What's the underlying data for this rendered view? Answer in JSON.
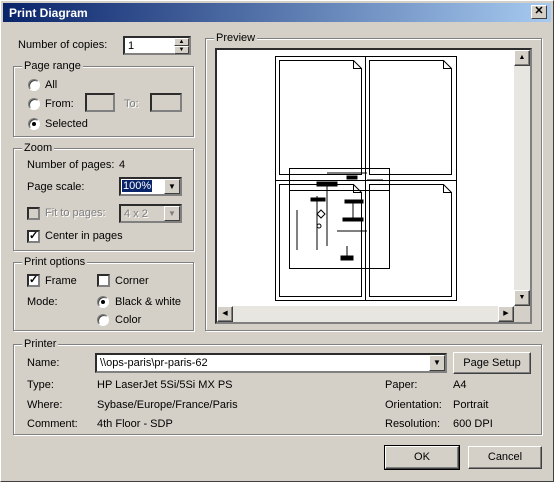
{
  "window": {
    "title": "Print Diagram",
    "close_glyph": "✕"
  },
  "copies": {
    "label": "Number of copies:",
    "value": "1"
  },
  "page_range": {
    "legend": "Page range",
    "all_label": "All",
    "from_label": "From:",
    "to_label": "To:",
    "selected_label": "Selected",
    "selected": "Selected"
  },
  "zoom": {
    "legend": "Zoom",
    "num_pages_label": "Number of pages:",
    "num_pages_value": "4",
    "page_scale_label": "Page scale:",
    "page_scale_value": "100%",
    "fit_label": "Fit to pages:",
    "fit_value": "4 x 2",
    "center_label": "Center in pages",
    "center_checked": true,
    "fit_checked": false
  },
  "print_options": {
    "legend": "Print options",
    "frame_label": "Frame",
    "frame_checked": true,
    "corner_label": "Corner",
    "corner_checked": false,
    "mode_label": "Mode:",
    "bw_label": "Black & white",
    "color_label": "Color",
    "mode": "Black & white"
  },
  "preview": {
    "legend": "Preview"
  },
  "printer": {
    "legend": "Printer",
    "name_label": "Name:",
    "name_value": "\\\\ops-paris\\pr-paris-62",
    "page_setup_label": "Page Setup",
    "type_label": "Type:",
    "type_value": "HP LaserJet 5Si/5Si MX PS",
    "where_label": "Where:",
    "where_value": "Sybase/Europe/France/Paris",
    "comment_label": "Comment:",
    "comment_value": "4th Floor - SDP",
    "paper_label": "Paper:",
    "paper_value": "A4",
    "orientation_label": "Orientation:",
    "orientation_value": "Portrait",
    "resolution_label": "Resolution:",
    "resolution_value": "600 DPI"
  },
  "buttons": {
    "ok": "OK",
    "cancel": "Cancel"
  }
}
